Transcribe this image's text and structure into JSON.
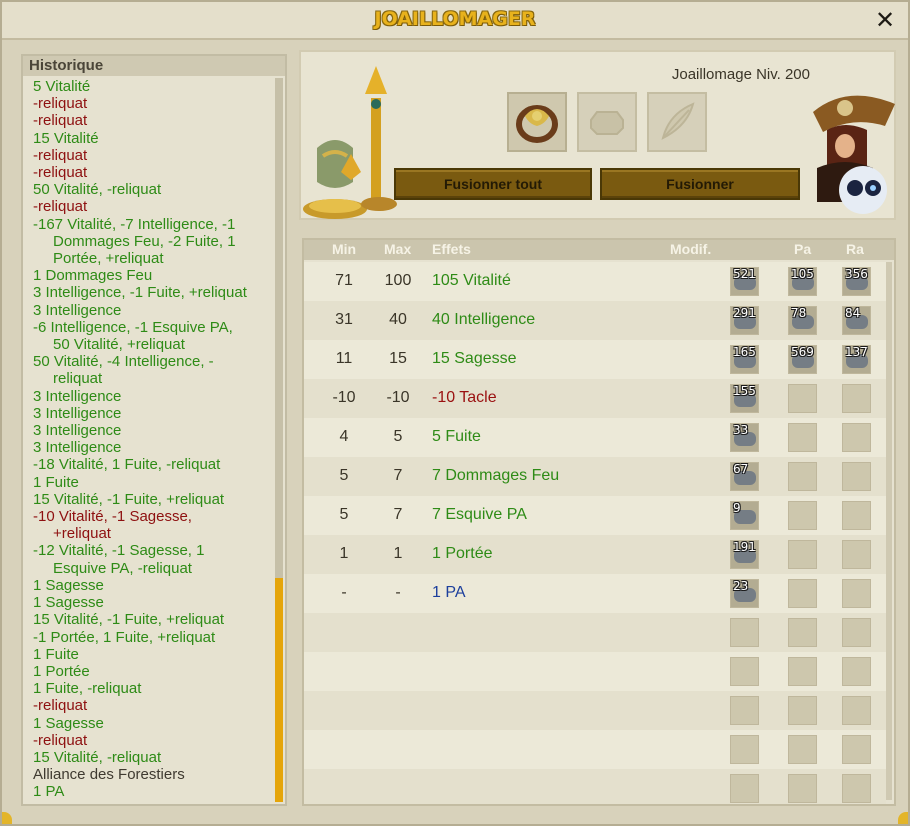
{
  "window": {
    "title": "JOAILLOMAGER",
    "close_icon": "close-icon"
  },
  "history": {
    "header": "Historique",
    "entries": [
      {
        "lines": [
          "5 Vitalité"
        ],
        "color": "green"
      },
      {
        "lines": [
          "-reliquat"
        ],
        "color": "red"
      },
      {
        "lines": [
          "-reliquat"
        ],
        "color": "red"
      },
      {
        "lines": [
          "15 Vitalité"
        ],
        "color": "green"
      },
      {
        "lines": [
          "-reliquat"
        ],
        "color": "red"
      },
      {
        "lines": [
          "-reliquat"
        ],
        "color": "red"
      },
      {
        "lines": [
          "50 Vitalité, -reliquat"
        ],
        "color": "green"
      },
      {
        "lines": [
          "-reliquat"
        ],
        "color": "red"
      },
      {
        "lines": [
          "-167 Vitalité, -7 Intelligence, -1",
          "Dommages Feu, -2 Fuite, 1",
          "Portée, +reliquat"
        ],
        "color": "green"
      },
      {
        "lines": [
          "1 Dommages Feu"
        ],
        "color": "green"
      },
      {
        "lines": [
          "3 Intelligence, -1 Fuite, +reliquat"
        ],
        "color": "green"
      },
      {
        "lines": [
          "3 Intelligence"
        ],
        "color": "green"
      },
      {
        "lines": [
          "-6 Intelligence, -1 Esquive PA,",
          "50 Vitalité, +reliquat"
        ],
        "color": "green"
      },
      {
        "lines": [
          "50 Vitalité, -4 Intelligence, -",
          "reliquat"
        ],
        "color": "green"
      },
      {
        "lines": [
          "3 Intelligence"
        ],
        "color": "green"
      },
      {
        "lines": [
          "3 Intelligence"
        ],
        "color": "green"
      },
      {
        "lines": [
          "3 Intelligence"
        ],
        "color": "green"
      },
      {
        "lines": [
          "3 Intelligence"
        ],
        "color": "green"
      },
      {
        "lines": [
          "-18 Vitalité, 1 Fuite, -reliquat"
        ],
        "color": "green"
      },
      {
        "lines": [
          "1 Fuite"
        ],
        "color": "green"
      },
      {
        "lines": [
          "15 Vitalité, -1 Fuite, +reliquat"
        ],
        "color": "green"
      },
      {
        "lines": [
          "-10 Vitalité, -1 Sagesse,",
          "+reliquat"
        ],
        "color": "red"
      },
      {
        "lines": [
          "-12 Vitalité, -1 Sagesse, 1",
          "Esquive PA, -reliquat"
        ],
        "color": "green"
      },
      {
        "lines": [
          "1 Sagesse"
        ],
        "color": "green"
      },
      {
        "lines": [
          "1 Sagesse"
        ],
        "color": "green"
      },
      {
        "lines": [
          "15 Vitalité, -1 Fuite, +reliquat"
        ],
        "color": "green"
      },
      {
        "lines": [
          "-1 Portée, 1 Fuite, +reliquat"
        ],
        "color": "green"
      },
      {
        "lines": [
          "1 Fuite"
        ],
        "color": "green"
      },
      {
        "lines": [
          "1 Portée"
        ],
        "color": "green"
      },
      {
        "lines": [
          "1 Fuite, -reliquat"
        ],
        "color": "green"
      },
      {
        "lines": [
          "-reliquat"
        ],
        "color": "red"
      },
      {
        "lines": [
          "1 Sagesse"
        ],
        "color": "green"
      },
      {
        "lines": [
          "-reliquat"
        ],
        "color": "red"
      },
      {
        "lines": [
          "15 Vitalité, -reliquat"
        ],
        "color": "green"
      },
      {
        "lines": [
          "Alliance des Forestiers"
        ],
        "color": "dark"
      },
      {
        "lines": [
          "1 PA"
        ],
        "color": "green"
      }
    ]
  },
  "craft": {
    "job_level": "Joaillomage Niv. 200",
    "slots": [
      {
        "name": "item-slot-ring",
        "icon": "ring-icon",
        "filled": true
      },
      {
        "name": "item-slot-signature",
        "icon": "signature-rune-icon",
        "filled": false
      },
      {
        "name": "item-slot-orb",
        "icon": "feather-icon",
        "filled": false
      }
    ],
    "fuse_all_label": "Fusionner tout",
    "fuse_label": "Fusionner"
  },
  "table": {
    "headers": {
      "min": "Min",
      "max": "Max",
      "effects": "Effets",
      "modif": "Modif.",
      "pa": "Pa",
      "ra": "Ra"
    },
    "rows": [
      {
        "min": "71",
        "max": "100",
        "effect": "105 Vitalité",
        "color": "green",
        "runes": [
          "521",
          "105",
          "356"
        ]
      },
      {
        "min": "31",
        "max": "40",
        "effect": "40 Intelligence",
        "color": "green",
        "runes": [
          "291",
          "78",
          "84"
        ]
      },
      {
        "min": "11",
        "max": "15",
        "effect": "15 Sagesse",
        "color": "green",
        "runes": [
          "165",
          "569",
          "137"
        ]
      },
      {
        "min": "-10",
        "max": "-10",
        "effect": "-10 Tacle",
        "color": "red",
        "runes": [
          "155",
          "",
          ""
        ]
      },
      {
        "min": "4",
        "max": "5",
        "effect": "5 Fuite",
        "color": "green",
        "runes": [
          "33",
          "",
          ""
        ]
      },
      {
        "min": "5",
        "max": "7",
        "effect": "7 Dommages Feu",
        "color": "green",
        "runes": [
          "67",
          "",
          ""
        ]
      },
      {
        "min": "5",
        "max": "7",
        "effect": "7 Esquive PA",
        "color": "green",
        "runes": [
          "9",
          "",
          ""
        ]
      },
      {
        "min": "1",
        "max": "1",
        "effect": "1 Portée",
        "color": "green",
        "runes": [
          "191",
          "",
          ""
        ]
      },
      {
        "min": "-",
        "max": "-",
        "effect": "1 PA",
        "color": "blue",
        "runes": [
          "23",
          "",
          ""
        ]
      },
      {
        "min": "",
        "max": "",
        "effect": "",
        "color": "green",
        "runes": [
          "",
          "",
          ""
        ]
      },
      {
        "min": "",
        "max": "",
        "effect": "",
        "color": "green",
        "runes": [
          "",
          "",
          ""
        ]
      },
      {
        "min": "",
        "max": "",
        "effect": "",
        "color": "green",
        "runes": [
          "",
          "",
          ""
        ]
      },
      {
        "min": "",
        "max": "",
        "effect": "",
        "color": "green",
        "runes": [
          "",
          "",
          ""
        ]
      },
      {
        "min": "",
        "max": "",
        "effect": "",
        "color": "green",
        "runes": [
          "",
          "",
          ""
        ]
      }
    ]
  },
  "colors": {
    "green": "#2e8b16",
    "red": "#9a1010",
    "blue": "#1c3f9c",
    "gold": "#e8b21c"
  }
}
